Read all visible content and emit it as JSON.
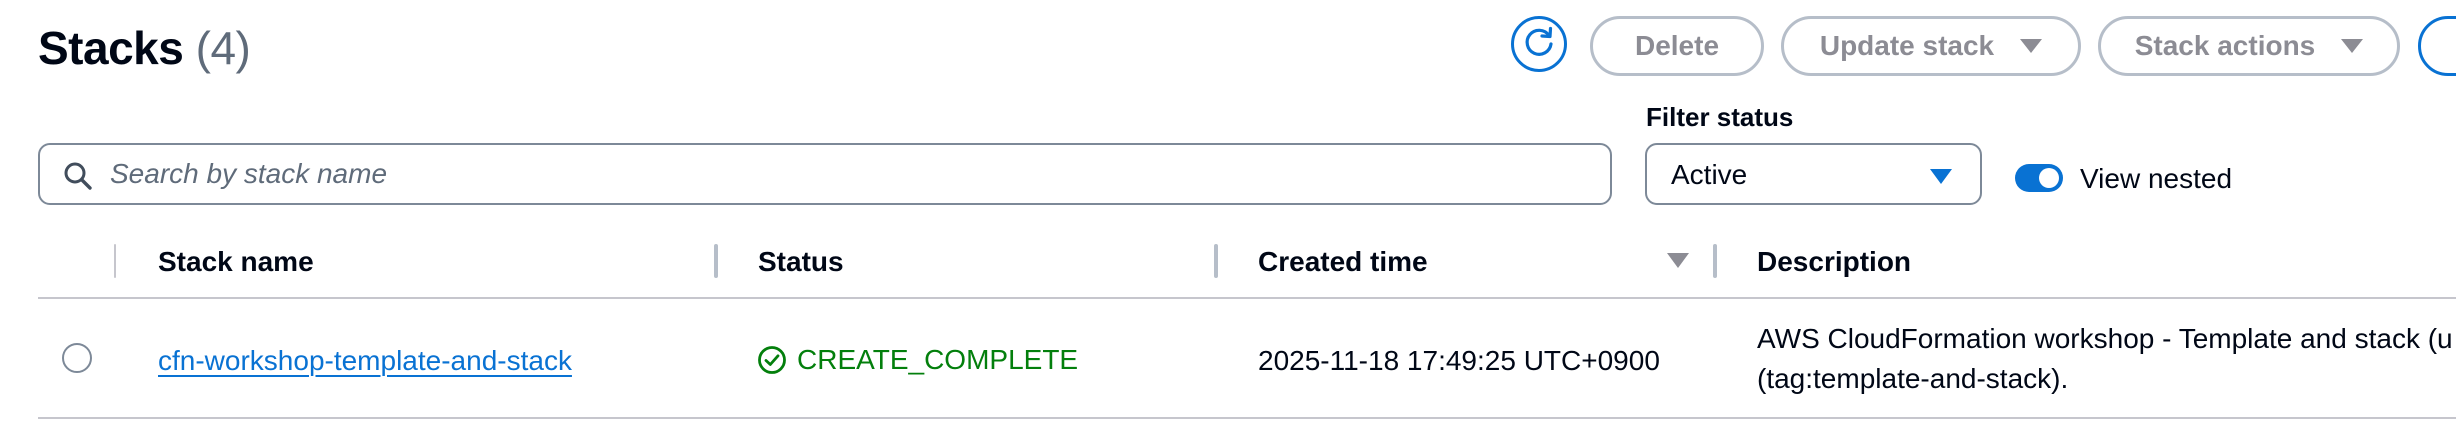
{
  "header": {
    "title": "Stacks",
    "count": "(4)"
  },
  "toolbar": {
    "refresh_icon": "refresh-icon",
    "delete_label": "Delete",
    "update_stack_label": "Update stack",
    "stack_actions_label": "Stack actions"
  },
  "filters": {
    "search_placeholder": "Search by stack name",
    "search_icon": "search-icon",
    "filter_status_label": "Filter status",
    "filter_status_value": "Active",
    "view_nested_label": "View nested",
    "view_nested_enabled": true
  },
  "table": {
    "columns": [
      "Stack name",
      "Status",
      "Created time",
      "Description"
    ],
    "sort_column": "Created time",
    "sort_direction": "descending",
    "rows": [
      {
        "stack_name": "cfn-workshop-template-and-stack",
        "status": "CREATE_COMPLETE",
        "status_icon": "check-circle-icon",
        "created_time": "2025-11-18 17:49:25 UTC+0900",
        "description_line1": "AWS CloudFormation workshop - Template and stack (u",
        "description_line2": "(tag:template-and-stack)."
      }
    ]
  },
  "colors": {
    "accent": "#0972d3",
    "success": "#037f0c",
    "disabled": "#8c8c94",
    "text": "#000716",
    "muted": "#5f6b7a"
  }
}
